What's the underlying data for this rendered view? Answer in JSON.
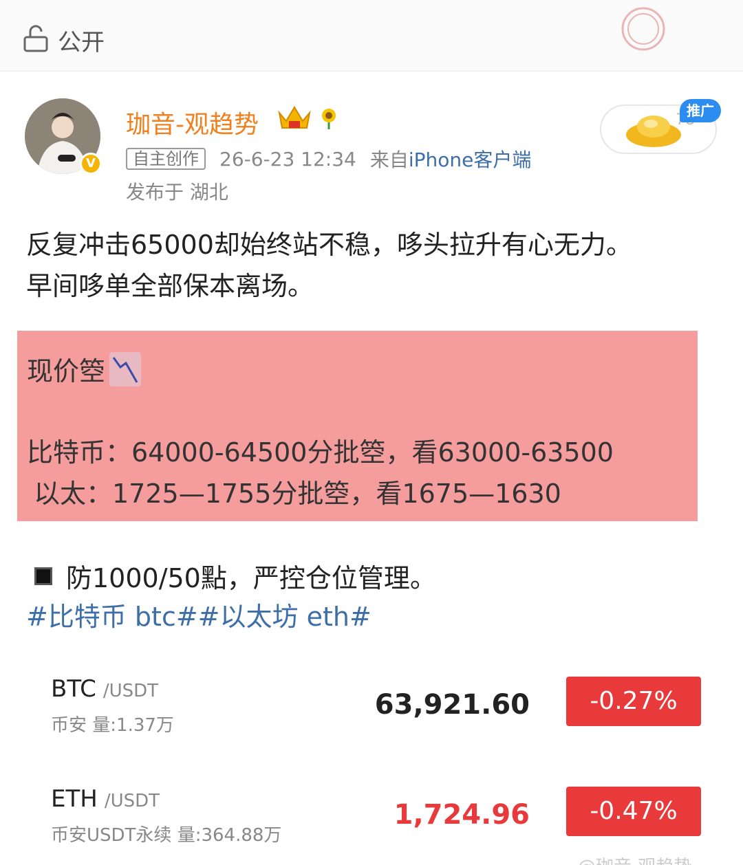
{
  "topbar": {
    "visibility_label": "公开"
  },
  "author": {
    "name": "珈音-观趋势",
    "tag": "自主创作",
    "time": "26-6-23 12:34",
    "from_prefix": "来自",
    "device": "iPhone客户端",
    "location": "发布于 湖北"
  },
  "promo": {
    "badge": "推广",
    "count": "78"
  },
  "post": {
    "line1": "反复冲击65000却始终站不稳，哆头拉升有心无力。",
    "line2": "早间哆单全部保本离场。"
  },
  "highlight": {
    "line1": "现价箜",
    "line2": "比特币：64000-64500分批箜，看63000-63500",
    "line3": "以太：1725—1755分批箜，看1675—1630"
  },
  "stop_line": "防1000/50點，严控仓位管理。",
  "hashtags": "#比特币 btc##以太坊 eth#",
  "tickers": [
    {
      "symbol": "BTC",
      "quote": "/USDT",
      "sub": "币安 量:1.37万",
      "price": "63,921.60",
      "change": "-0.27%",
      "price_color": "#222222"
    },
    {
      "symbol": "ETH",
      "quote": "/USDT",
      "sub": "币安USDT永续 量:364.88万",
      "price": "1,724.96",
      "change": "-0.47%",
      "price_color": "#e83a3a"
    }
  ],
  "watermark": "@珈音-观趋势",
  "colors": {
    "username": "#f0801e",
    "link": "#3d6ea8",
    "highlight_bg": "#f59c9c",
    "down": "#e83a3a"
  }
}
